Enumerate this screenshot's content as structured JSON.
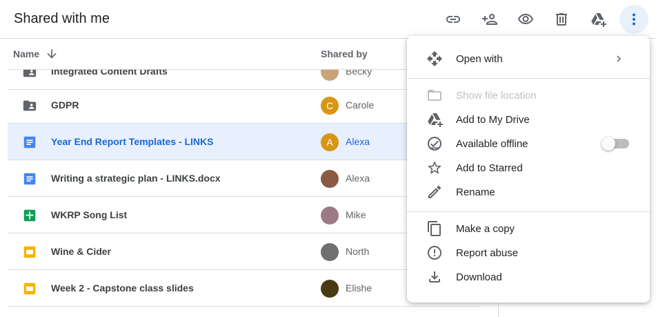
{
  "header": {
    "title": "Shared with me",
    "toolbar": [
      "link-icon",
      "add-person-icon",
      "preview-eye-icon",
      "trash-icon",
      "add-to-drive-icon",
      "more-vert-icon"
    ]
  },
  "columns": {
    "name": "Name",
    "shared_by": "Shared by",
    "sort": "arrow-down-icon"
  },
  "files": [
    {
      "name": "Integrated Content Drafts",
      "icon": "shared-folder-icon",
      "owner": "Becky",
      "avatar_letter": "",
      "avatar_color": "#c9a37a",
      "selected": false
    },
    {
      "name": "GDPR",
      "icon": "shared-folder-icon",
      "owner": "Carole",
      "avatar_letter": "C",
      "avatar_color": "#d89614",
      "selected": false
    },
    {
      "name": "Year End Report Templates - LINKS",
      "icon": "docs-icon",
      "owner": "Alexa",
      "avatar_letter": "A",
      "avatar_color": "#d89614",
      "selected": true
    },
    {
      "name": "Writing a strategic plan - LINKS.docx",
      "icon": "docs-icon",
      "owner": "Alexa",
      "avatar_letter": "",
      "avatar_color": "#8a5a44",
      "selected": false
    },
    {
      "name": "WKRP Song List",
      "icon": "sheets-icon",
      "owner": "Mike",
      "avatar_letter": "",
      "avatar_color": "#9c7b86",
      "selected": false
    },
    {
      "name": "Wine & Cider",
      "icon": "slides-icon",
      "owner": "North",
      "avatar_letter": "",
      "avatar_color": "#6f6f6f",
      "selected": false
    },
    {
      "name": "Week 2 - Capstone class slides",
      "icon": "slides-icon",
      "owner": "Elishe",
      "avatar_letter": "",
      "avatar_color": "#4a3a12",
      "selected": false
    }
  ],
  "menu": {
    "open_with": "Open with",
    "show_file_location": "Show file location",
    "add_to_my_drive": "Add to My Drive",
    "available_offline": "Available offline",
    "add_to_starred": "Add to Starred",
    "rename": "Rename",
    "make_a_copy": "Make a copy",
    "report_abuse": "Report abuse",
    "download": "Download"
  },
  "colors": {
    "accent": "#1967d2",
    "selected_row": "#e8f0fe",
    "docs": "#4285f4",
    "sheets": "#0f9d58",
    "slides": "#f4b400",
    "folder": "#5f6368"
  }
}
